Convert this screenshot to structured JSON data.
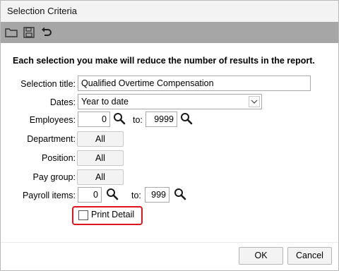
{
  "window": {
    "title": "Selection Criteria"
  },
  "toolbar": [
    {
      "icon": "folder-icon",
      "name": "open"
    },
    {
      "icon": "save-icon",
      "name": "save"
    },
    {
      "icon": "undo-icon",
      "name": "undo"
    }
  ],
  "heading": "Each selection you make will reduce the number of results in the report.",
  "fields": {
    "selection_title": {
      "label": "Selection title:",
      "value": "Qualified Overtime Compensation"
    },
    "dates": {
      "label": "Dates:",
      "value": "Year to date"
    },
    "employees": {
      "label": "Employees:",
      "from": "0",
      "to_label": "to:",
      "to": "9999"
    },
    "department": {
      "label": "Department:",
      "button": "All"
    },
    "position": {
      "label": "Position:",
      "button": "All"
    },
    "pay_group": {
      "label": "Pay group:",
      "button": "All"
    },
    "payroll_items": {
      "label": "Payroll items:",
      "from": "0",
      "to_label": "to:",
      "to": "999"
    },
    "print_detail": {
      "label": "Print Detail",
      "checked": false,
      "highlight_color": "#e0141e"
    }
  },
  "footer": {
    "ok": "OK",
    "cancel": "Cancel"
  }
}
